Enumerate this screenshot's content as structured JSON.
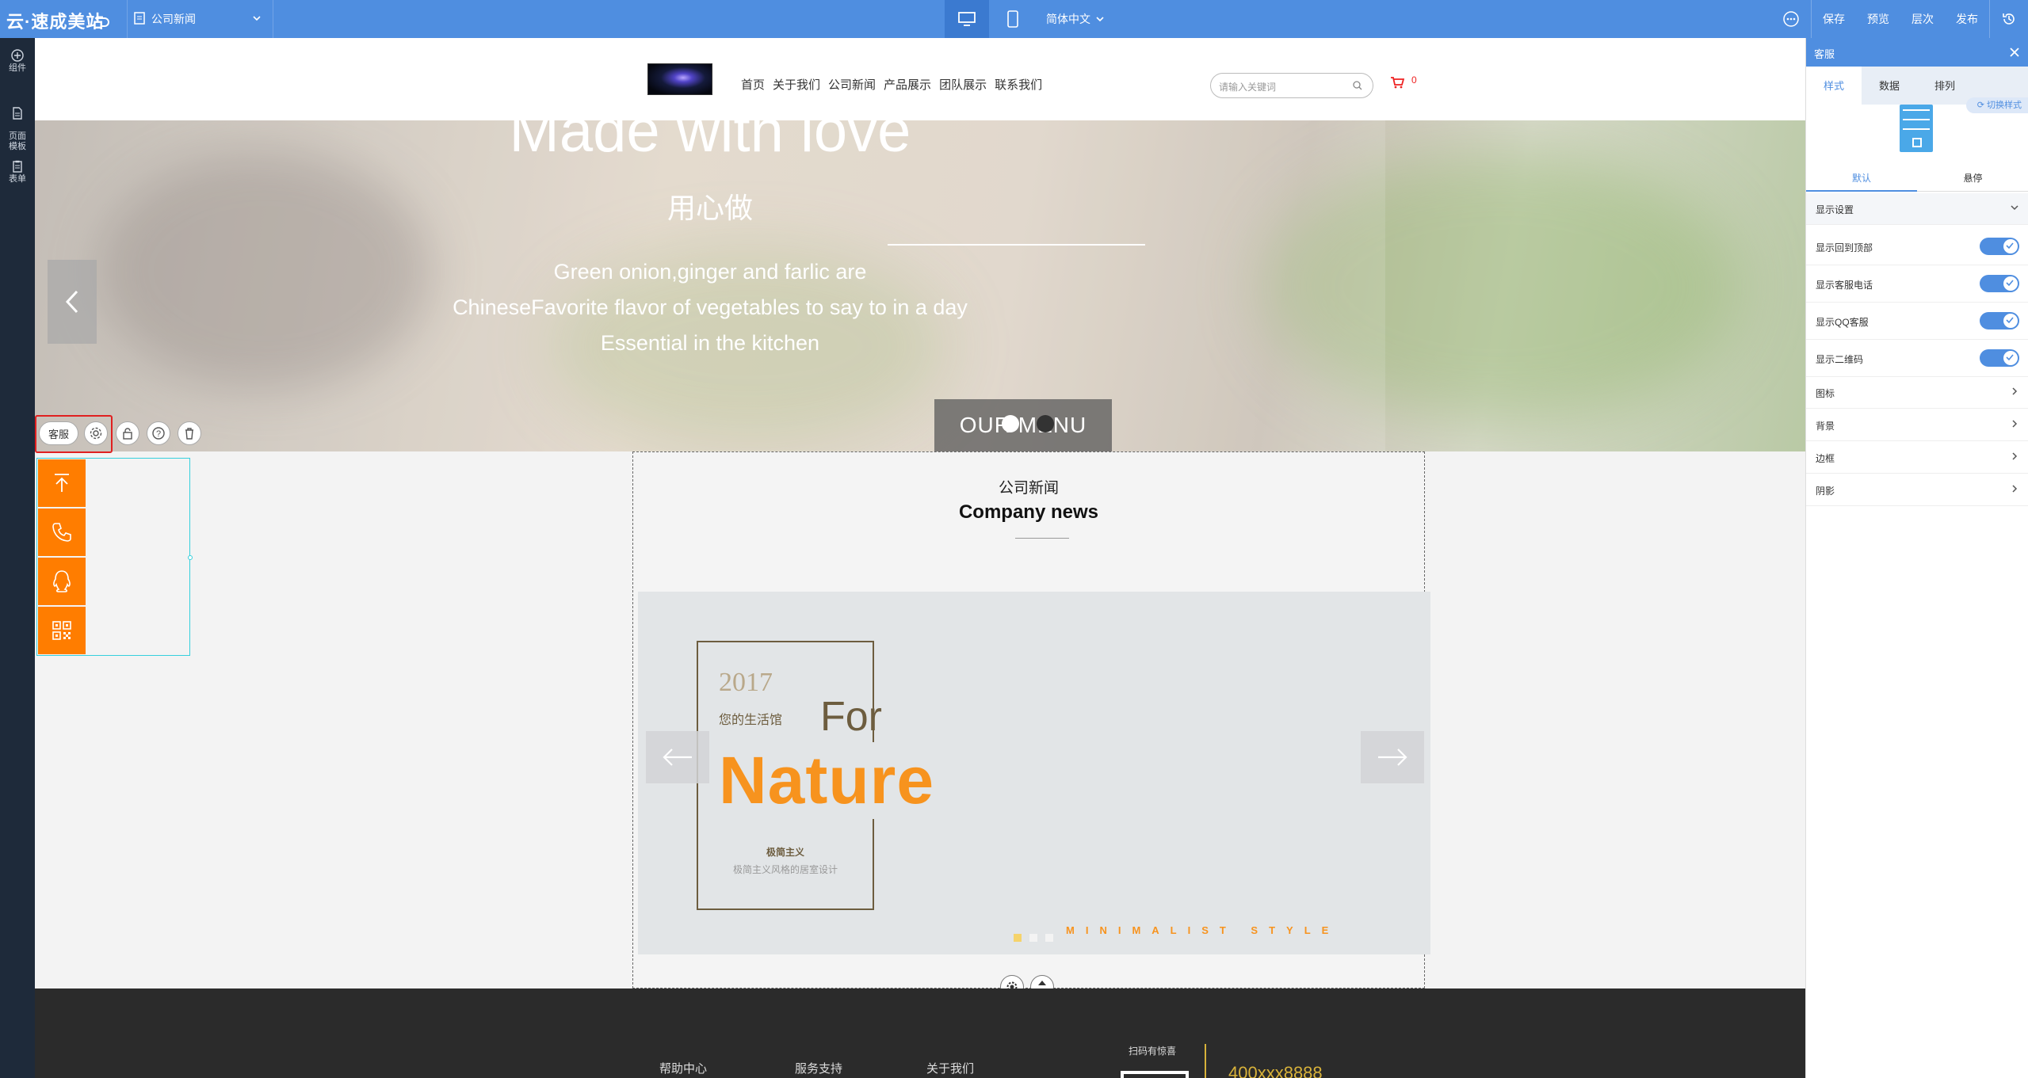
{
  "topbar": {
    "logo": "云·速成美站",
    "page_selector": "公司新闻",
    "language": "简体中文",
    "actions": [
      "保存",
      "预览",
      "层次",
      "发布"
    ]
  },
  "leftbar": {
    "items": [
      {
        "label": "组件",
        "icon": "plus-circle-icon"
      },
      {
        "label": "页面\n模板",
        "icon": "page-icon"
      },
      {
        "label": "表单",
        "icon": "clipboard-icon"
      }
    ]
  },
  "site": {
    "nav": [
      "首页",
      "关于我们",
      "公司新闻",
      "产品展示",
      "团队展示",
      "联系我们"
    ],
    "search_placeholder": "请输入关键词",
    "cart_count": "0",
    "hero": {
      "title": "Made with love",
      "subtitle": "用心做",
      "lines": [
        "Green onion,ginger and farlic are",
        "ChineseFavorite flavor of vegetables to say to in a day",
        "Essential in the kitchen"
      ],
      "button": "OUR MENU"
    },
    "news": {
      "title_cn": "公司新闻",
      "title_en": "Company news",
      "slide": {
        "year": "2017",
        "sub": "您的生活馆",
        "for": "For",
        "nature": "Nature",
        "minimal_title": "极简主义",
        "minimal_desc": "极简主义风格的居室设计",
        "style_text": "MINIMALIST STYLE"
      }
    },
    "footer": {
      "cols": [
        "帮助中心",
        "服务支持",
        "关于我们"
      ],
      "qr_label": "扫码有惊喜",
      "phone": "400xxx8888"
    }
  },
  "widget": {
    "label": "客服",
    "buttons": [
      "back-to-top",
      "phone",
      "qq",
      "qrcode"
    ]
  },
  "panel": {
    "title": "客服",
    "tabs": [
      "样式",
      "数据",
      "排列"
    ],
    "switch_style": "切换样式",
    "state_tabs": [
      "默认",
      "悬停"
    ],
    "section": "显示设置",
    "toggles": [
      {
        "label": "显示回到顶部",
        "on": true
      },
      {
        "label": "显示客服电话",
        "on": true
      },
      {
        "label": "显示QQ客服",
        "on": true
      },
      {
        "label": "显示二维码",
        "on": true
      }
    ],
    "groups": [
      "图标",
      "背景",
      "边框",
      "阴影"
    ]
  },
  "colors": {
    "accent": "#4f8ee0",
    "widget_orange": "#ff7d00",
    "nature_orange": "#f7931e",
    "footer": "#2b2b2b"
  }
}
